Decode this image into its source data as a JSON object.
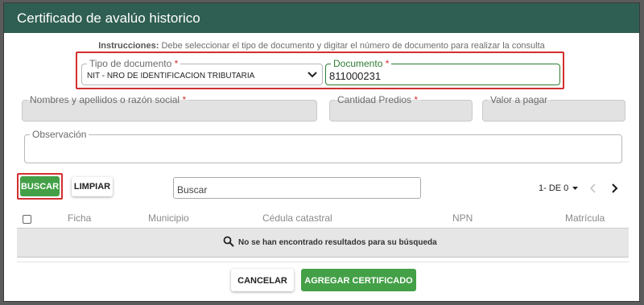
{
  "window": {
    "title": "Certificado de avalúo historico"
  },
  "instructions": {
    "label": "Instrucciones:",
    "text": "Debe seleccionar el tipo de documento y digitar el número de documento para realizar la consulta"
  },
  "form": {
    "tipo_documento": {
      "label": "Tipo de documento",
      "required": "*",
      "value": "NIT - NRO DE IDENTIFICACION TRIBUTARIA"
    },
    "documento": {
      "label": "Documento",
      "required": "*",
      "value": "811000231"
    },
    "nombres": {
      "label": "Nombres y apellidos o razón social",
      "required": "*"
    },
    "cantidad_predios": {
      "label": "Cantidad Predios",
      "required": "*"
    },
    "valor_pagar": {
      "label": "Valor a pagar"
    },
    "observacion": {
      "label": "Observación"
    }
  },
  "toolbar": {
    "buscar_label": "BUSCAR",
    "limpiar_label": "LIMPIAR",
    "search_placeholder": "Buscar"
  },
  "pager": {
    "range": "1- DE 0"
  },
  "table": {
    "columns": [
      "Ficha",
      "Municipio",
      "Cédula catastral",
      "NPN",
      "Matrícula"
    ],
    "empty_message": "No se han encontrado resultados para su búsqueda"
  },
  "footer": {
    "cancel_label": "CANCELAR",
    "add_label": "AGREGAR CERTIFICADO"
  },
  "colors": {
    "titlebar": "#2f5f52",
    "accent_green": "#43a047",
    "highlight_red": "#d32f2f"
  }
}
